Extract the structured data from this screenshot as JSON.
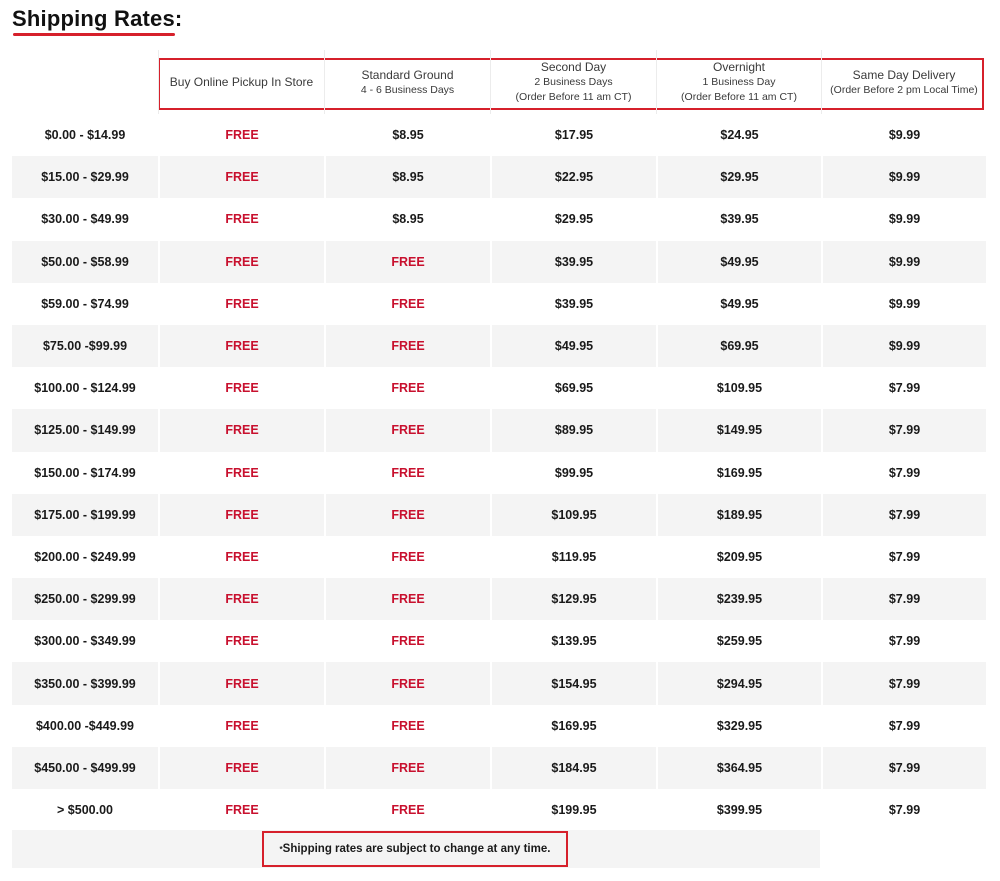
{
  "title": "Shipping Rates:",
  "columns": [
    {
      "main": "Buy Online Pickup In Store",
      "sub": []
    },
    {
      "main": "Standard Ground",
      "sub": [
        "4 - 6 Business Days"
      ]
    },
    {
      "main": "Second Day",
      "sub": [
        "2 Business Days",
        "(Order Before 11 am CT)"
      ]
    },
    {
      "main": "Overnight",
      "sub": [
        "1 Business Day",
        "(Order Before 11 am CT)"
      ]
    },
    {
      "main": "Same Day Delivery",
      "sub": [
        "(Order Before 2 pm Local Time)"
      ]
    }
  ],
  "rows": [
    {
      "range": "$0.00 - $14.99",
      "pickup": "FREE",
      "ground": "$8.95",
      "second": "$17.95",
      "overnight": "$24.95",
      "sameday": "$9.99"
    },
    {
      "range": "$15.00 - $29.99",
      "pickup": "FREE",
      "ground": "$8.95",
      "second": "$22.95",
      "overnight": "$29.95",
      "sameday": "$9.99"
    },
    {
      "range": "$30.00 - $49.99",
      "pickup": "FREE",
      "ground": "$8.95",
      "second": "$29.95",
      "overnight": "$39.95",
      "sameday": "$9.99"
    },
    {
      "range": "$50.00 - $58.99",
      "pickup": "FREE",
      "ground": "FREE",
      "second": "$39.95",
      "overnight": "$49.95",
      "sameday": "$9.99"
    },
    {
      "range": "$59.00 - $74.99",
      "pickup": "FREE",
      "ground": "FREE",
      "second": "$39.95",
      "overnight": "$49.95",
      "sameday": "$9.99"
    },
    {
      "range": "$75.00 -$99.99",
      "pickup": "FREE",
      "ground": "FREE",
      "second": "$49.95",
      "overnight": "$69.95",
      "sameday": "$9.99"
    },
    {
      "range": "$100.00 - $124.99",
      "pickup": "FREE",
      "ground": "FREE",
      "second": "$69.95",
      "overnight": "$109.95",
      "sameday": "$7.99"
    },
    {
      "range": "$125.00 - $149.99",
      "pickup": "FREE",
      "ground": "FREE",
      "second": "$89.95",
      "overnight": "$149.95",
      "sameday": "$7.99"
    },
    {
      "range": "$150.00 - $174.99",
      "pickup": "FREE",
      "ground": "FREE",
      "second": "$99.95",
      "overnight": "$169.95",
      "sameday": "$7.99"
    },
    {
      "range": "$175.00 - $199.99",
      "pickup": "FREE",
      "ground": "FREE",
      "second": "$109.95",
      "overnight": "$189.95",
      "sameday": "$7.99"
    },
    {
      "range": "$200.00 - $249.99",
      "pickup": "FREE",
      "ground": "FREE",
      "second": "$119.95",
      "overnight": "$209.95",
      "sameday": "$7.99"
    },
    {
      "range": "$250.00 - $299.99",
      "pickup": "FREE",
      "ground": "FREE",
      "second": "$129.95",
      "overnight": "$239.95",
      "sameday": "$7.99"
    },
    {
      "range": "$300.00 - $349.99",
      "pickup": "FREE",
      "ground": "FREE",
      "second": "$139.95",
      "overnight": "$259.95",
      "sameday": "$7.99"
    },
    {
      "range": "$350.00 - $399.99",
      "pickup": "FREE",
      "ground": "FREE",
      "second": "$154.95",
      "overnight": "$294.95",
      "sameday": "$7.99"
    },
    {
      "range": "$400.00 -$449.99",
      "pickup": "FREE",
      "ground": "FREE",
      "second": "$169.95",
      "overnight": "$329.95",
      "sameday": "$7.99"
    },
    {
      "range": "$450.00 - $499.99",
      "pickup": "FREE",
      "ground": "FREE",
      "second": "$184.95",
      "overnight": "$364.95",
      "sameday": "$7.99"
    },
    {
      "range": "> $500.00",
      "pickup": "FREE",
      "ground": "FREE",
      "second": "$199.95",
      "overnight": "$399.95",
      "sameday": "$7.99"
    }
  ],
  "footnote": {
    "marker": "*",
    "text": "Shipping rates are subject to change at any time."
  },
  "colors": {
    "accent": "#d6202b",
    "free": "#c8102e",
    "row_alt": "#f4f4f4"
  }
}
